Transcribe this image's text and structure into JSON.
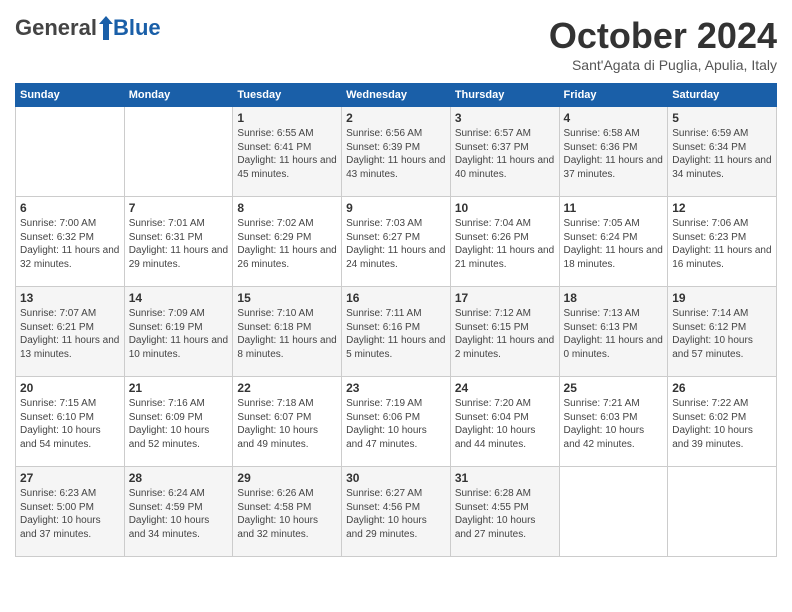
{
  "header": {
    "logo_general": "General",
    "logo_blue": "Blue",
    "month_title": "October 2024",
    "location": "Sant'Agata di Puglia, Apulia, Italy"
  },
  "days_of_week": [
    "Sunday",
    "Monday",
    "Tuesday",
    "Wednesday",
    "Thursday",
    "Friday",
    "Saturday"
  ],
  "weeks": [
    [
      {
        "day": "",
        "content": ""
      },
      {
        "day": "",
        "content": ""
      },
      {
        "day": "1",
        "content": "Sunrise: 6:55 AM\nSunset: 6:41 PM\nDaylight: 11 hours and 45 minutes."
      },
      {
        "day": "2",
        "content": "Sunrise: 6:56 AM\nSunset: 6:39 PM\nDaylight: 11 hours and 43 minutes."
      },
      {
        "day": "3",
        "content": "Sunrise: 6:57 AM\nSunset: 6:37 PM\nDaylight: 11 hours and 40 minutes."
      },
      {
        "day": "4",
        "content": "Sunrise: 6:58 AM\nSunset: 6:36 PM\nDaylight: 11 hours and 37 minutes."
      },
      {
        "day": "5",
        "content": "Sunrise: 6:59 AM\nSunset: 6:34 PM\nDaylight: 11 hours and 34 minutes."
      }
    ],
    [
      {
        "day": "6",
        "content": "Sunrise: 7:00 AM\nSunset: 6:32 PM\nDaylight: 11 hours and 32 minutes."
      },
      {
        "day": "7",
        "content": "Sunrise: 7:01 AM\nSunset: 6:31 PM\nDaylight: 11 hours and 29 minutes."
      },
      {
        "day": "8",
        "content": "Sunrise: 7:02 AM\nSunset: 6:29 PM\nDaylight: 11 hours and 26 minutes."
      },
      {
        "day": "9",
        "content": "Sunrise: 7:03 AM\nSunset: 6:27 PM\nDaylight: 11 hours and 24 minutes."
      },
      {
        "day": "10",
        "content": "Sunrise: 7:04 AM\nSunset: 6:26 PM\nDaylight: 11 hours and 21 minutes."
      },
      {
        "day": "11",
        "content": "Sunrise: 7:05 AM\nSunset: 6:24 PM\nDaylight: 11 hours and 18 minutes."
      },
      {
        "day": "12",
        "content": "Sunrise: 7:06 AM\nSunset: 6:23 PM\nDaylight: 11 hours and 16 minutes."
      }
    ],
    [
      {
        "day": "13",
        "content": "Sunrise: 7:07 AM\nSunset: 6:21 PM\nDaylight: 11 hours and 13 minutes."
      },
      {
        "day": "14",
        "content": "Sunrise: 7:09 AM\nSunset: 6:19 PM\nDaylight: 11 hours and 10 minutes."
      },
      {
        "day": "15",
        "content": "Sunrise: 7:10 AM\nSunset: 6:18 PM\nDaylight: 11 hours and 8 minutes."
      },
      {
        "day": "16",
        "content": "Sunrise: 7:11 AM\nSunset: 6:16 PM\nDaylight: 11 hours and 5 minutes."
      },
      {
        "day": "17",
        "content": "Sunrise: 7:12 AM\nSunset: 6:15 PM\nDaylight: 11 hours and 2 minutes."
      },
      {
        "day": "18",
        "content": "Sunrise: 7:13 AM\nSunset: 6:13 PM\nDaylight: 11 hours and 0 minutes."
      },
      {
        "day": "19",
        "content": "Sunrise: 7:14 AM\nSunset: 6:12 PM\nDaylight: 10 hours and 57 minutes."
      }
    ],
    [
      {
        "day": "20",
        "content": "Sunrise: 7:15 AM\nSunset: 6:10 PM\nDaylight: 10 hours and 54 minutes."
      },
      {
        "day": "21",
        "content": "Sunrise: 7:16 AM\nSunset: 6:09 PM\nDaylight: 10 hours and 52 minutes."
      },
      {
        "day": "22",
        "content": "Sunrise: 7:18 AM\nSunset: 6:07 PM\nDaylight: 10 hours and 49 minutes."
      },
      {
        "day": "23",
        "content": "Sunrise: 7:19 AM\nSunset: 6:06 PM\nDaylight: 10 hours and 47 minutes."
      },
      {
        "day": "24",
        "content": "Sunrise: 7:20 AM\nSunset: 6:04 PM\nDaylight: 10 hours and 44 minutes."
      },
      {
        "day": "25",
        "content": "Sunrise: 7:21 AM\nSunset: 6:03 PM\nDaylight: 10 hours and 42 minutes."
      },
      {
        "day": "26",
        "content": "Sunrise: 7:22 AM\nSunset: 6:02 PM\nDaylight: 10 hours and 39 minutes."
      }
    ],
    [
      {
        "day": "27",
        "content": "Sunrise: 6:23 AM\nSunset: 5:00 PM\nDaylight: 10 hours and 37 minutes."
      },
      {
        "day": "28",
        "content": "Sunrise: 6:24 AM\nSunset: 4:59 PM\nDaylight: 10 hours and 34 minutes."
      },
      {
        "day": "29",
        "content": "Sunrise: 6:26 AM\nSunset: 4:58 PM\nDaylight: 10 hours and 32 minutes."
      },
      {
        "day": "30",
        "content": "Sunrise: 6:27 AM\nSunset: 4:56 PM\nDaylight: 10 hours and 29 minutes."
      },
      {
        "day": "31",
        "content": "Sunrise: 6:28 AM\nSunset: 4:55 PM\nDaylight: 10 hours and 27 minutes."
      },
      {
        "day": "",
        "content": ""
      },
      {
        "day": "",
        "content": ""
      }
    ]
  ]
}
